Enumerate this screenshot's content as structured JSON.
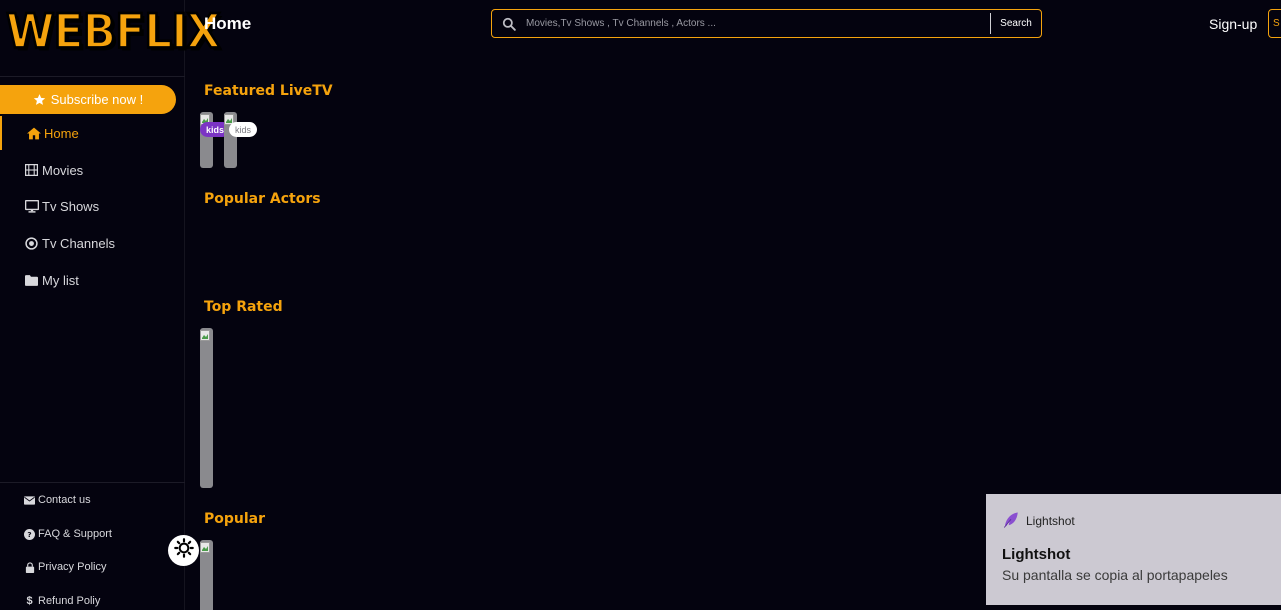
{
  "brand": {
    "logo_text": "WEBFLIX",
    "accent": "#f5a30d",
    "background": "#04030f"
  },
  "sidebar": {
    "subscribe_label": "Subscribe now !",
    "nav": [
      {
        "label": "Home",
        "icon": "home-icon",
        "active": true
      },
      {
        "label": "Movies",
        "icon": "film-icon",
        "active": false
      },
      {
        "label": "Tv Shows",
        "icon": "monitor-icon",
        "active": false
      },
      {
        "label": "Tv Channels",
        "icon": "target-icon",
        "active": false
      },
      {
        "label": "My list",
        "icon": "folder-icon",
        "active": false
      }
    ],
    "footer": [
      {
        "label": "Contact us",
        "icon": "envelope-icon"
      },
      {
        "label": "FAQ & Support",
        "icon": "question-circle-icon"
      },
      {
        "label": "Privacy Policy",
        "icon": "lock-icon"
      },
      {
        "label": "Refund Poliy",
        "icon": "dollar-icon"
      }
    ]
  },
  "header": {
    "page_title": "Home",
    "search_placeholder": "Movies,Tv Shows , Tv Channels , Actors ...",
    "search_button": "Search",
    "signup_label": "Sign-up",
    "corner_button_label": "S"
  },
  "sections": {
    "featured_livetv": {
      "title": "Featured LiveTV",
      "badges": [
        "kids",
        "kids"
      ]
    },
    "popular_actors": {
      "title": "Popular Actors"
    },
    "top_rated": {
      "title": "Top Rated"
    },
    "popular": {
      "title": "Popular"
    }
  },
  "toast": {
    "app_name": "Lightshot",
    "title": "Lightshot",
    "message": "Su pantalla se copia al portapapeles"
  }
}
